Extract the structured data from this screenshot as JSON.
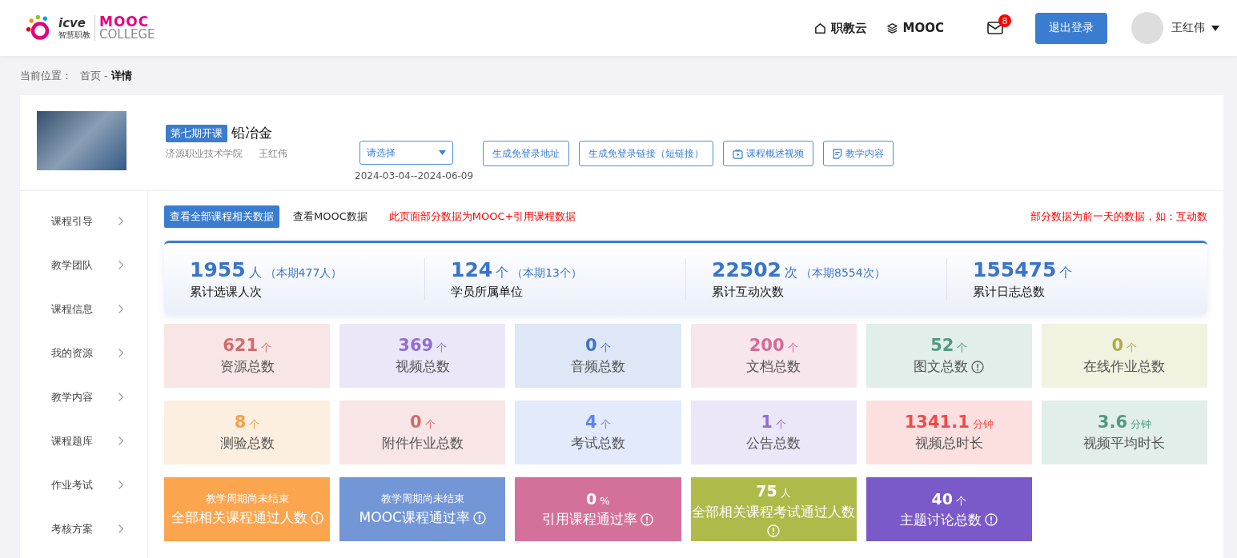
{
  "header": {
    "logo": {
      "brand": "icve",
      "brand_sub": "智慧职教",
      "name": "MOOC",
      "name_sub": "COLLEGE"
    },
    "nav": [
      {
        "label": "职教云"
      },
      {
        "label": "MOOC"
      }
    ],
    "messages": {
      "count": "8"
    },
    "logout": "退出登录",
    "user": "王红伟"
  },
  "breadcrumb": {
    "prefix": "当前位置：",
    "items": [
      {
        "label": "首页",
        "current": false
      },
      {
        "label": "详情",
        "current": true
      }
    ],
    "separator": "-"
  },
  "course": {
    "tag": "第七期开课",
    "title": "铅冶金",
    "school": "济源职业技术学院",
    "teacher": "王红伟",
    "select": {
      "placeholder": "请选择"
    },
    "dates": "2024-03-04--2024-06-09",
    "buttons": [
      {
        "label": "生成免登录地址",
        "kind": "text"
      },
      {
        "label": "生成免登录链接（短链接）",
        "kind": "text"
      },
      {
        "label": "课程概述视频",
        "kind": "video"
      },
      {
        "label": "教学内容",
        "kind": "document"
      }
    ]
  },
  "sidebar": {
    "items": [
      {
        "label": "课程引导"
      },
      {
        "label": "教学团队"
      },
      {
        "label": "课程信息"
      },
      {
        "label": "我的资源"
      },
      {
        "label": "教学内容"
      },
      {
        "label": "课程题库"
      },
      {
        "label": "作业考试"
      },
      {
        "label": "考核方案"
      }
    ]
  },
  "tabs": [
    {
      "label": "查看全部课程相关数据",
      "selected": true
    },
    {
      "label": "查看MOOC数据",
      "selected": false
    }
  ],
  "notice_left": "此页面部分数据为MOOC+引用课程数据",
  "notice_right": "部分数据为前一天的数据，如：互动数",
  "summary": [
    {
      "value": "1955",
      "unit": "人",
      "period": "（本期477人）",
      "label": "累计选课人次"
    },
    {
      "value": "124",
      "unit": "个",
      "period": "（本期13个）",
      "label": "学员所属单位"
    },
    {
      "value": "22502",
      "unit": "次",
      "period": "（本期8554次）",
      "label": "累计互动次数"
    },
    {
      "value": "155475",
      "unit": "个",
      "label": "累计日志总数"
    }
  ],
  "tiles": [
    {
      "kind": "light",
      "color": "#d46a6a",
      "value": "621",
      "unit": "个",
      "label": "资源总数",
      "info": false
    },
    {
      "kind": "light",
      "color": "#8e6fd6",
      "value": "369",
      "unit": "个",
      "label": "视频总数",
      "info": false
    },
    {
      "kind": "light",
      "color": "#3f73c9",
      "value": "0",
      "unit": "个",
      "label": "音频总数",
      "info": false
    },
    {
      "kind": "light",
      "color": "#d46a98",
      "value": "200",
      "unit": "个",
      "label": "文档总数",
      "info": false
    },
    {
      "kind": "light",
      "color": "#4f9a80",
      "value": "52",
      "unit": "个",
      "label": "图文总数",
      "info": true
    },
    {
      "kind": "light",
      "color": "#aab04a",
      "value": "0",
      "unit": "个",
      "label": "在线作业总数",
      "info": false
    },
    {
      "kind": "light",
      "color": "#f5a04a",
      "value": "8",
      "unit": "个",
      "label": "测验总数",
      "info": false
    },
    {
      "kind": "light",
      "color": "#d46a6a",
      "value": "0",
      "unit": "个",
      "label": "附件作业总数",
      "info": false
    },
    {
      "kind": "light",
      "color": "#5b85ef",
      "value": "4",
      "unit": "个",
      "label": "考试总数",
      "info": false
    },
    {
      "kind": "light",
      "color": "#8e6fd6",
      "value": "1",
      "unit": "个",
      "label": "公告总数",
      "info": false
    },
    {
      "kind": "light",
      "color": "#ef4a4a",
      "value": "1341.1",
      "unit": "分钟",
      "label": "视频总时长",
      "info": false
    },
    {
      "kind": "light",
      "color": "#4f9a80",
      "value": "3.6",
      "unit": "分钟",
      "label": "视频平均时长",
      "info": false
    },
    {
      "kind": "solid",
      "color": "#fba54f",
      "note": "教学周期尚未结束",
      "label": "全部相关课程通过人数",
      "info": true
    },
    {
      "kind": "solid",
      "color": "#7396d6",
      "note": "教学周期尚未结束",
      "label": "MOOC课程通过率",
      "info": true
    },
    {
      "kind": "solid",
      "color": "#d4719b",
      "value": "0",
      "unit": "%",
      "label": "引用课程通过率",
      "info": true
    },
    {
      "kind": "solid",
      "color": "#aebb4a",
      "value": "75",
      "unit": "人",
      "label": "全部相关课程考试通过人数",
      "info": true
    },
    {
      "kind": "solid",
      "color": "#7a59c9",
      "value": "40",
      "unit": "个",
      "label": "主题讨论总数",
      "info": true
    }
  ]
}
